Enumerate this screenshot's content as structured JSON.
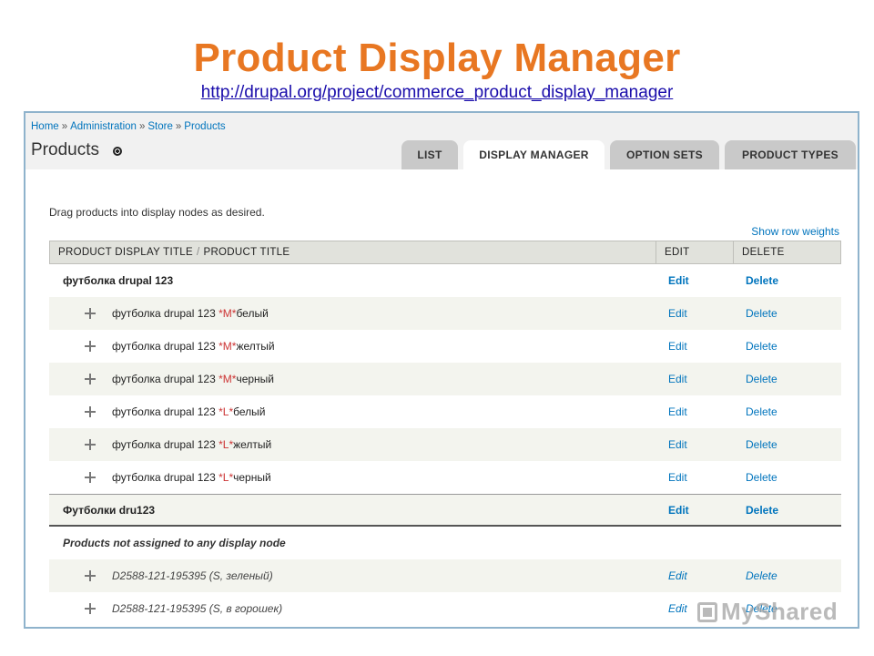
{
  "slide": {
    "title": "Product Display Manager",
    "link": "http://drupal.org/project/commerce_product_display_manager"
  },
  "breadcrumb": [
    "Home",
    "Administration",
    "Store",
    "Products"
  ],
  "breadcrumb_separator": "»",
  "page": {
    "title": "Products",
    "intro": "Drag products into display nodes as desired.",
    "show_row_weights": "Show row weights"
  },
  "tabs": [
    {
      "label": "LIST",
      "active": false
    },
    {
      "label": "DISPLAY MANAGER",
      "active": true
    },
    {
      "label": "OPTION SETS",
      "active": false
    },
    {
      "label": "PRODUCT TYPES",
      "active": false
    }
  ],
  "table": {
    "headers": {
      "title_a": "PRODUCT DISPLAY TITLE",
      "title_sep": "/",
      "title_b": "PRODUCT TITLE",
      "edit": "EDIT",
      "delete": "DELETE"
    },
    "groups": [
      {
        "name": "футболка drupal 123",
        "edit": "Edit",
        "delete": "Delete",
        "children": [
          {
            "base": "футболка drupal 123 ",
            "attr": "*M*",
            "suffix": "белый",
            "edit": "Edit",
            "delete": "Delete"
          },
          {
            "base": "футболка drupal 123 ",
            "attr": "*M*",
            "suffix": "желтый",
            "edit": "Edit",
            "delete": "Delete"
          },
          {
            "base": "футболка drupal 123 ",
            "attr": "*M*",
            "suffix": "черный",
            "edit": "Edit",
            "delete": "Delete"
          },
          {
            "base": "футболка drupal 123 ",
            "attr": "*L*",
            "suffix": "белый",
            "edit": "Edit",
            "delete": "Delete"
          },
          {
            "base": "футболка drupal 123 ",
            "attr": "*L*",
            "suffix": "желтый",
            "edit": "Edit",
            "delete": "Delete"
          },
          {
            "base": "футболка drupal 123 ",
            "attr": "*L*",
            "suffix": "черный",
            "edit": "Edit",
            "delete": "Delete"
          }
        ]
      },
      {
        "name": "Футболки dru123",
        "edit": "Edit",
        "delete": "Delete",
        "children": []
      }
    ],
    "unassigned": {
      "label": "Products not assigned to any display node",
      "items": [
        {
          "title": "D2588-121-195395 (S, зеленый)",
          "edit": "Edit",
          "delete": "Delete"
        },
        {
          "title": "D2588-121-195395 (S, в горошек)",
          "edit": "Edit",
          "delete": "Delete"
        }
      ]
    }
  },
  "watermark": "MyShared"
}
